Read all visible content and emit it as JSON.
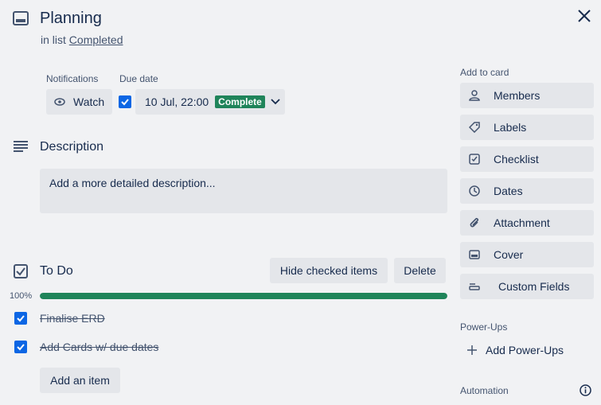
{
  "card": {
    "title": "Planning",
    "in_list_prefix": "in list",
    "list_name": "Completed"
  },
  "notifications": {
    "label": "Notifications",
    "watch_label": "Watch"
  },
  "due_date": {
    "label": "Due date",
    "value": "10 Jul, 22:00",
    "status": "Complete",
    "checked": true
  },
  "description": {
    "heading": "Description",
    "placeholder": "Add a more detailed description..."
  },
  "checklist": {
    "title": "To Do",
    "hide_label": "Hide checked items",
    "delete_label": "Delete",
    "progress_text": "100%",
    "progress": 1.0,
    "items": [
      {
        "text": "Finalise ERD",
        "checked": true
      },
      {
        "text": "Add Cards w/ due dates",
        "checked": true
      }
    ],
    "add_item_label": "Add an item"
  },
  "sidebar": {
    "add_to_card_heading": "Add to card",
    "buttons": [
      {
        "label": "Members",
        "icon": "person-icon"
      },
      {
        "label": "Labels",
        "icon": "tag-icon"
      },
      {
        "label": "Checklist",
        "icon": "checklist-icon"
      },
      {
        "label": "Dates",
        "icon": "clock-icon"
      },
      {
        "label": "Attachment",
        "icon": "paperclip-icon"
      },
      {
        "label": "Cover",
        "icon": "cover-icon"
      },
      {
        "label": "Custom Fields",
        "icon": "custom-fields-icon"
      }
    ],
    "power_ups_heading": "Power-Ups",
    "add_power_ups_label": "Add Power-Ups",
    "automation_heading": "Automation"
  },
  "colors": {
    "background": "#f1f2f4",
    "button": "#e4e6ea",
    "complete_badge": "#1f845a",
    "checkbox": "#0c66e4",
    "progress": "#1f845a"
  }
}
